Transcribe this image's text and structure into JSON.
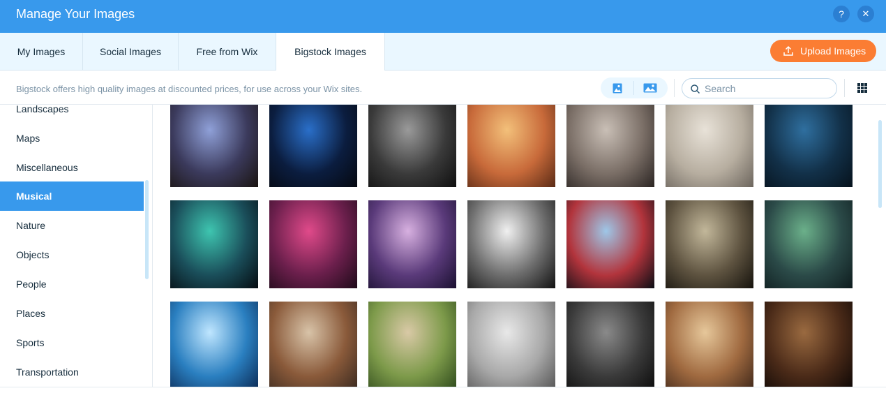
{
  "window": {
    "title": "Manage Your Images",
    "help_label": "?",
    "close_label": "✕"
  },
  "tabs": [
    {
      "label": "My Images",
      "active": false
    },
    {
      "label": "Social Images",
      "active": false
    },
    {
      "label": "Free from Wix",
      "active": false
    },
    {
      "label": "Bigstock Images",
      "active": true
    }
  ],
  "upload_button": {
    "label": "Upload Images",
    "icon": "upload-icon",
    "color": "#fb7d33"
  },
  "info_text": "Bigstock offers high quality images at discounted prices, for use across your Wix sites.",
  "view_toggle": [
    {
      "icon": "portrait-image-icon"
    },
    {
      "icon": "landscape-image-icon"
    }
  ],
  "search": {
    "placeholder": "Search",
    "value": "",
    "icon": "search-icon"
  },
  "grid_view_icon": "grid-view-icon",
  "categories": [
    {
      "label": "Landscapes",
      "active": false
    },
    {
      "label": "Maps",
      "active": false
    },
    {
      "label": "Miscellaneous",
      "active": false
    },
    {
      "label": "Musical",
      "active": true
    },
    {
      "label": "Nature",
      "active": false
    },
    {
      "label": "Objects",
      "active": false
    },
    {
      "label": "People",
      "active": false
    },
    {
      "label": "Places",
      "active": false
    },
    {
      "label": "Sports",
      "active": false
    },
    {
      "label": "Transportation",
      "active": false
    }
  ],
  "thumbnails": [
    {
      "subject": "concert-crowd",
      "colors": [
        "#8fa0d8",
        "#3b3a5c",
        "#1a1410"
      ]
    },
    {
      "subject": "dj-stage-lights",
      "colors": [
        "#2a6fc9",
        "#0b1d3f",
        "#05080f"
      ]
    },
    {
      "subject": "electric-guitar-bw",
      "colors": [
        "#9a9a9a",
        "#3a3a3a",
        "#0f0f0f"
      ]
    },
    {
      "subject": "microphone-bokeh",
      "colors": [
        "#f3c07a",
        "#c86a3a",
        "#5a2a15"
      ]
    },
    {
      "subject": "vinyl-turntable",
      "colors": [
        "#c9bfb6",
        "#7a6e66",
        "#2a2422"
      ]
    },
    {
      "subject": "girl-headphones",
      "colors": [
        "#e8e2d8",
        "#b7aea0",
        "#6c655d"
      ]
    },
    {
      "subject": "band-on-stage",
      "colors": [
        "#2f6f9f",
        "#123048",
        "#06121c"
      ]
    },
    {
      "subject": "heart-hands-concert",
      "colors": [
        "#3ec5b0",
        "#1a4e5a",
        "#050b10"
      ]
    },
    {
      "subject": "studio-microphone",
      "colors": [
        "#e04a8a",
        "#6b1f4c",
        "#1d0a18"
      ]
    },
    {
      "subject": "play-button-touch",
      "colors": [
        "#d7b0e0",
        "#5a3a7a",
        "#1a1030"
      ]
    },
    {
      "subject": "crowd-bw",
      "colors": [
        "#f0f0f0",
        "#6e6e6e",
        "#111111"
      ]
    },
    {
      "subject": "confetti-stage",
      "colors": [
        "#9ec7e8",
        "#b2343c",
        "#0a0d14"
      ]
    },
    {
      "subject": "drummer",
      "colors": [
        "#c2b79a",
        "#5e5340",
        "#15120c"
      ]
    },
    {
      "subject": "mixing-console",
      "colors": [
        "#6bb08a",
        "#2b4a48",
        "#0e1c1e"
      ]
    },
    {
      "subject": "stage-light-beams",
      "colors": [
        "#bfe6ff",
        "#2a7fc0",
        "#0b2a55"
      ]
    },
    {
      "subject": "children-ukulele",
      "colors": [
        "#d8c3a8",
        "#8a5a3a",
        "#3a2a20"
      ]
    },
    {
      "subject": "woman-headphones-grass",
      "colors": [
        "#d9c9a6",
        "#7d9a4a",
        "#2e4a1c"
      ]
    },
    {
      "subject": "vintage-microphone",
      "colors": [
        "#e8e8e8",
        "#a8a8a8",
        "#555555"
      ]
    },
    {
      "subject": "guitar-strings-bw",
      "colors": [
        "#8a8a8a",
        "#3a3a3a",
        "#0c0c0c"
      ]
    },
    {
      "subject": "acoustic-guitar-hands",
      "colors": [
        "#e6c79a",
        "#a06a40",
        "#40281a"
      ]
    },
    {
      "subject": "ukulele-drum",
      "colors": [
        "#9a6a40",
        "#4a2a18",
        "#0d0705"
      ]
    }
  ]
}
